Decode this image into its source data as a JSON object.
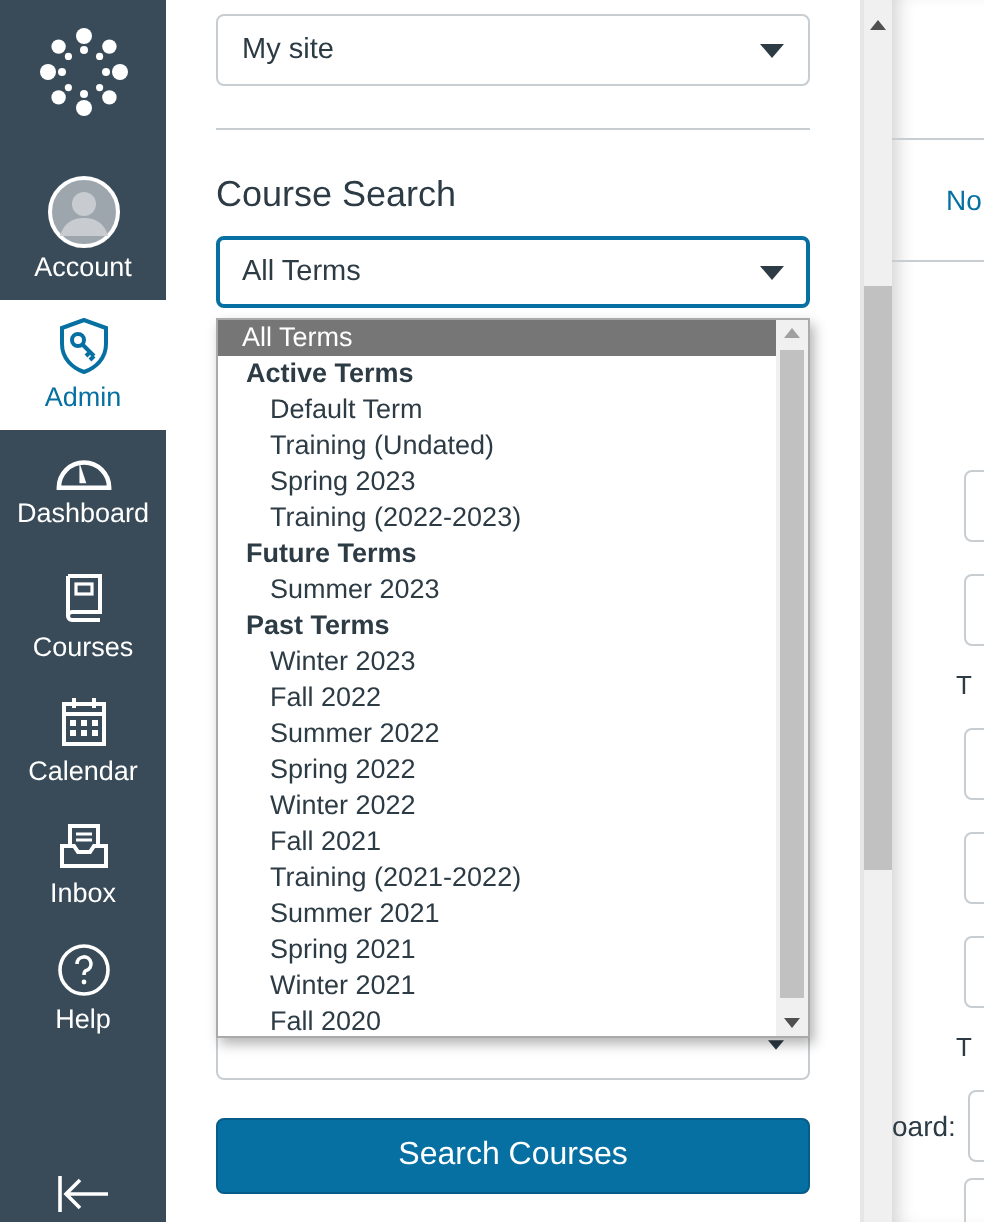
{
  "nav": {
    "items": [
      {
        "label": "Account",
        "kind": "avatar",
        "selected": false
      },
      {
        "label": "Admin",
        "kind": "shield",
        "selected": true
      },
      {
        "label": "Dashboard",
        "kind": "gauge",
        "selected": false
      },
      {
        "label": "Courses",
        "kind": "book",
        "selected": false
      },
      {
        "label": "Calendar",
        "kind": "calendar",
        "selected": false
      },
      {
        "label": "Inbox",
        "kind": "inbox",
        "selected": false
      },
      {
        "label": "Help",
        "kind": "help",
        "selected": false
      }
    ]
  },
  "tray": {
    "site_select": {
      "value": "My site"
    },
    "heading": "Course Search",
    "term_select": {
      "value": "All Terms",
      "expanded": true,
      "options": [
        {
          "label": "All Terms",
          "kind": "option",
          "selected": true
        },
        {
          "label": "Active Terms",
          "kind": "group"
        },
        {
          "label": "Default Term",
          "kind": "option",
          "selected": false
        },
        {
          "label": "Training (Undated)",
          "kind": "option",
          "selected": false
        },
        {
          "label": "Spring 2023",
          "kind": "option",
          "selected": false
        },
        {
          "label": "Training (2022-2023)",
          "kind": "option",
          "selected": false
        },
        {
          "label": "Future Terms",
          "kind": "group"
        },
        {
          "label": "Summer 2023",
          "kind": "option",
          "selected": false
        },
        {
          "label": "Past Terms",
          "kind": "group"
        },
        {
          "label": "Winter 2023",
          "kind": "option",
          "selected": false
        },
        {
          "label": "Fall 2022",
          "kind": "option",
          "selected": false
        },
        {
          "label": "Summer 2022",
          "kind": "option",
          "selected": false
        },
        {
          "label": "Spring 2022",
          "kind": "option",
          "selected": false
        },
        {
          "label": "Winter 2022",
          "kind": "option",
          "selected": false
        },
        {
          "label": "Fall 2021",
          "kind": "option",
          "selected": false
        },
        {
          "label": "Training (2021-2022)",
          "kind": "option",
          "selected": false
        },
        {
          "label": "Summer 2021",
          "kind": "option",
          "selected": false
        },
        {
          "label": "Spring 2021",
          "kind": "option",
          "selected": false
        },
        {
          "label": "Winter 2021",
          "kind": "option",
          "selected": false
        },
        {
          "label": "Fall 2020",
          "kind": "option",
          "selected": false
        }
      ]
    },
    "button": "Search Courses"
  },
  "background": {
    "link": "No",
    "texts": [
      "T",
      "T",
      "oard:"
    ]
  }
}
